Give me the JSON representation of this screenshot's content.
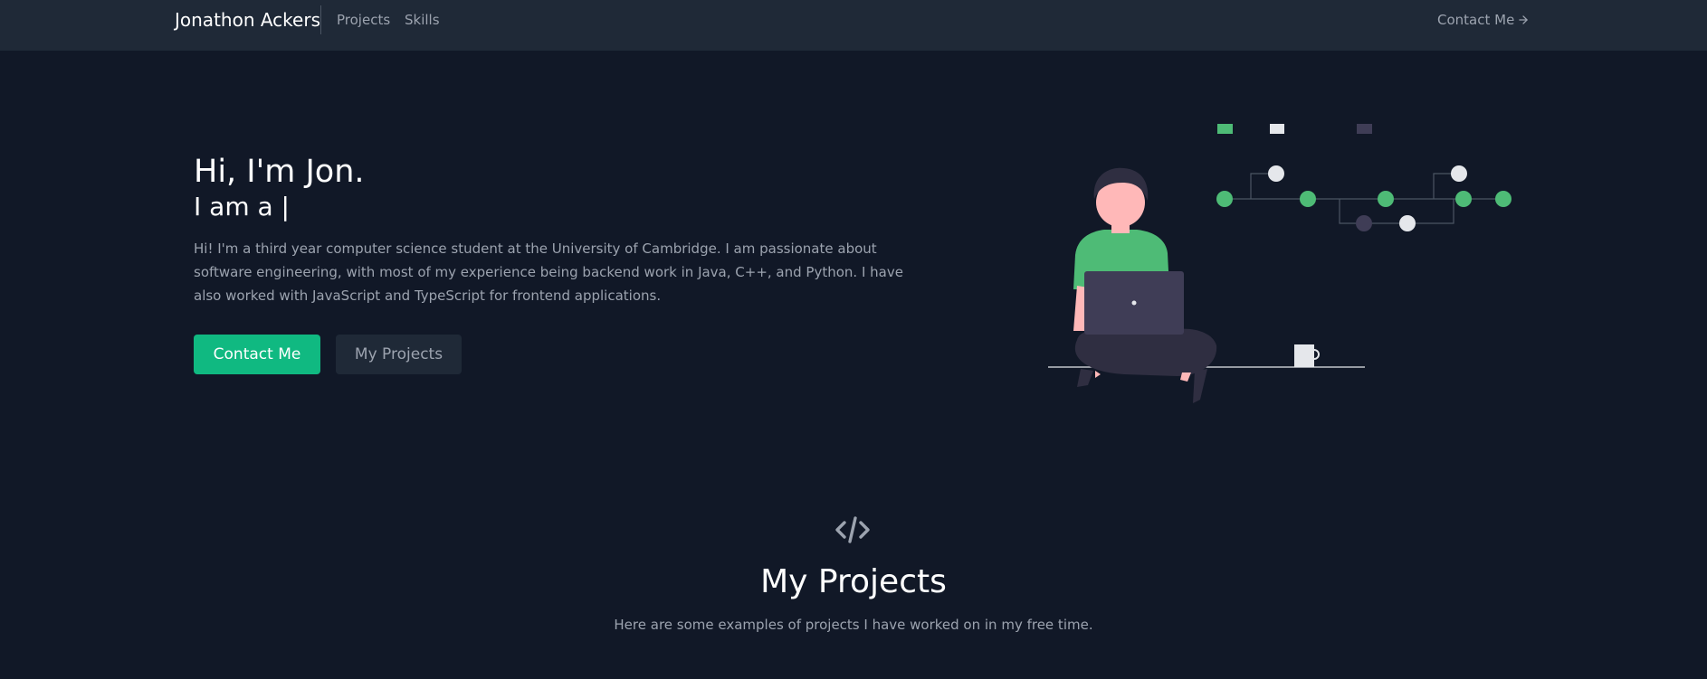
{
  "nav": {
    "brand": "Jonathon Ackers",
    "links": [
      {
        "label": "Projects"
      },
      {
        "label": "Skills"
      }
    ],
    "contact_label": "Contact Me"
  },
  "hero": {
    "title": "Hi, I'm Jon.",
    "subtitle": "I am a |",
    "description": "Hi! I'm a third year computer science student at the University of Cambridge. I am passionate about software engineering, with most of my experience being backend work in Java, C++, and Python. I have also worked with JavaScript and TypeScript for frontend applications.",
    "primary_button": "Contact Me",
    "secondary_button": "My Projects"
  },
  "projects_section": {
    "icon": "code-icon",
    "title": "My Projects",
    "subtitle": "Here are some examples of projects I have worked on in my free time."
  },
  "colors": {
    "background": "#111827",
    "navbar": "#1f2937",
    "accent": "#10b981",
    "illustration_green": "#4ebb76",
    "text_muted": "#9ca3af"
  }
}
